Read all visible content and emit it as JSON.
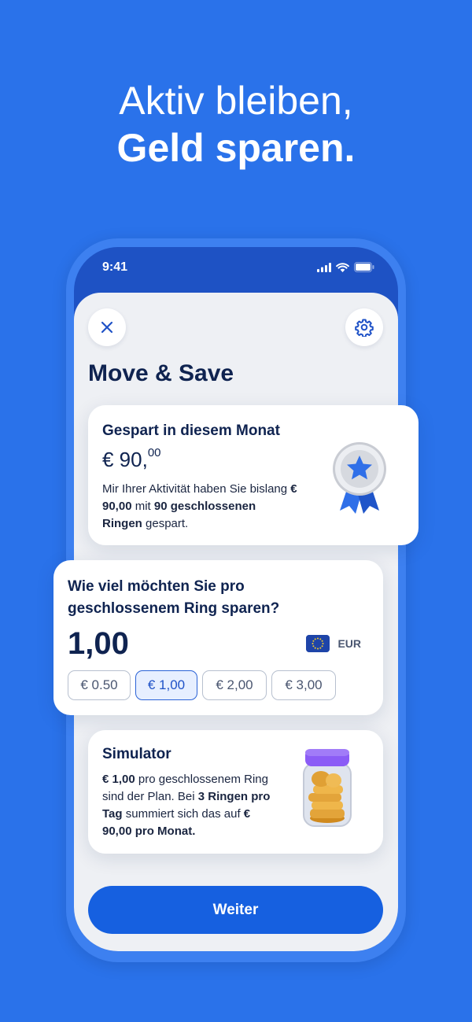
{
  "headline": {
    "line1": "Aktiv bleiben,",
    "line2": "Geld sparen."
  },
  "status_bar": {
    "time": "9:41"
  },
  "header": {
    "title": "Move & Save",
    "close_icon": "close-icon",
    "settings_icon": "gear-icon"
  },
  "savings_card": {
    "title": "Gespart in diesem Monat",
    "amount_main": "€ 90,",
    "amount_cents": "00",
    "desc_1": "Mir Ihrer Aktivität haben Sie bislang ",
    "desc_amount": "€ 90,00",
    "desc_2": " mit ",
    "desc_count": "90 geschlossenen Ringen",
    "desc_3": " gespart.",
    "illustration": "medal-icon"
  },
  "ring_card": {
    "title": "Wie viel möchten Sie pro geschlossenem Ring sparen?",
    "amount": "1,00",
    "currency": "EUR",
    "currency_icon": "eu-flag-icon",
    "options": [
      "€ 0.50",
      "€ 1,00",
      "€ 2,00",
      "€ 3,00"
    ],
    "selected_option": "€ 1,00"
  },
  "simulator_card": {
    "title": "Simulator",
    "desc_amount": "€ 1,00",
    "desc_1": " pro geschlossenem Ring sind der Plan. Bei ",
    "desc_rings": "3 Ringen pro Tag",
    "desc_2": " summiert sich das auf ",
    "desc_total": "€ 90,00 pro Monat.",
    "illustration": "coin-jar-icon"
  },
  "footer": {
    "continue_label": "Weiter"
  },
  "colors": {
    "background": "#2a72ea",
    "accent": "#1660e0",
    "title_text": "#0f2350",
    "selected_chip_bg": "#e7efff"
  }
}
